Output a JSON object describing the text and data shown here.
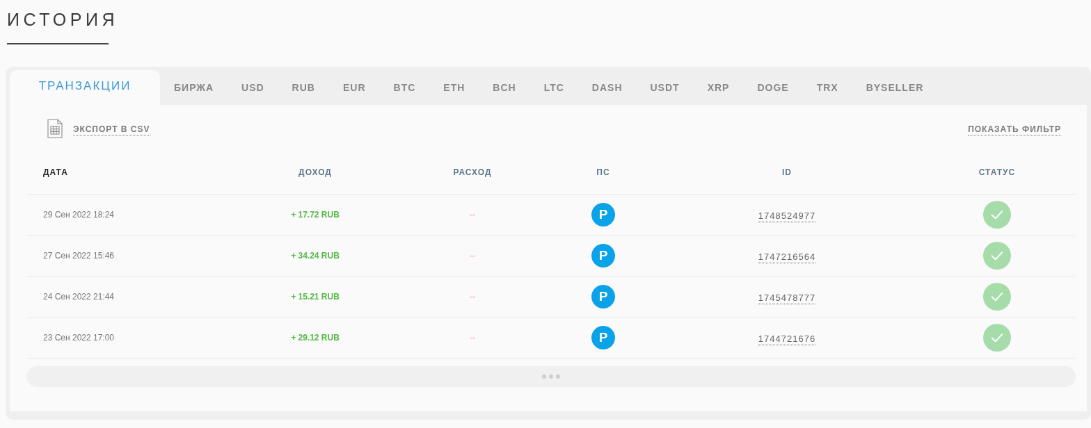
{
  "page": {
    "title": "ИСТОРИЯ"
  },
  "tabs": [
    {
      "label": "ТРАНЗАКЦИИ",
      "selected": true
    },
    {
      "label": "БИРЖА",
      "selected": false
    },
    {
      "label": "USD",
      "selected": false
    },
    {
      "label": "RUB",
      "selected": false
    },
    {
      "label": "EUR",
      "selected": false
    },
    {
      "label": "BTC",
      "selected": false
    },
    {
      "label": "ETH",
      "selected": false
    },
    {
      "label": "BCH",
      "selected": false
    },
    {
      "label": "LTC",
      "selected": false
    },
    {
      "label": "DASH",
      "selected": false
    },
    {
      "label": "USDT",
      "selected": false
    },
    {
      "label": "XRP",
      "selected": false
    },
    {
      "label": "DOGE",
      "selected": false
    },
    {
      "label": "TRX",
      "selected": false
    },
    {
      "label": "BYSELLER",
      "selected": false
    }
  ],
  "toolbar": {
    "export_link": "ЭКСПОРТ В CSV",
    "filter_link": "ПОКАЗАТЬ ФИЛЬТР"
  },
  "table": {
    "columns": [
      {
        "label": "ДАТА",
        "sorted": true
      },
      {
        "label": "ДОХОД",
        "sorted": false
      },
      {
        "label": "РАСХОД",
        "sorted": false
      },
      {
        "label": "ПС",
        "sorted": false
      },
      {
        "label": "ID",
        "sorted": false
      },
      {
        "label": "СТАТУС",
        "sorted": false
      }
    ],
    "rows": [
      {
        "date": "29 Сен 2022 18:24",
        "income": "+ 17.72 RUB",
        "expense": "--",
        "ps": "P",
        "id": "1748524977",
        "completed": true
      },
      {
        "date": "27 Сен 2022 15:46",
        "income": "+ 34.24 RUB",
        "expense": "--",
        "ps": "P",
        "id": "1747216564",
        "completed": true
      },
      {
        "date": "24 Сен 2022 21:44",
        "income": "+ 15.21 RUB",
        "expense": "--",
        "ps": "P",
        "id": "1745478777",
        "completed": true
      },
      {
        "date": "23 Сен 2022 17:00",
        "income": "+ 29.12 RUB",
        "expense": "--",
        "ps": "P",
        "id": "1744721676",
        "completed": true
      }
    ]
  }
}
